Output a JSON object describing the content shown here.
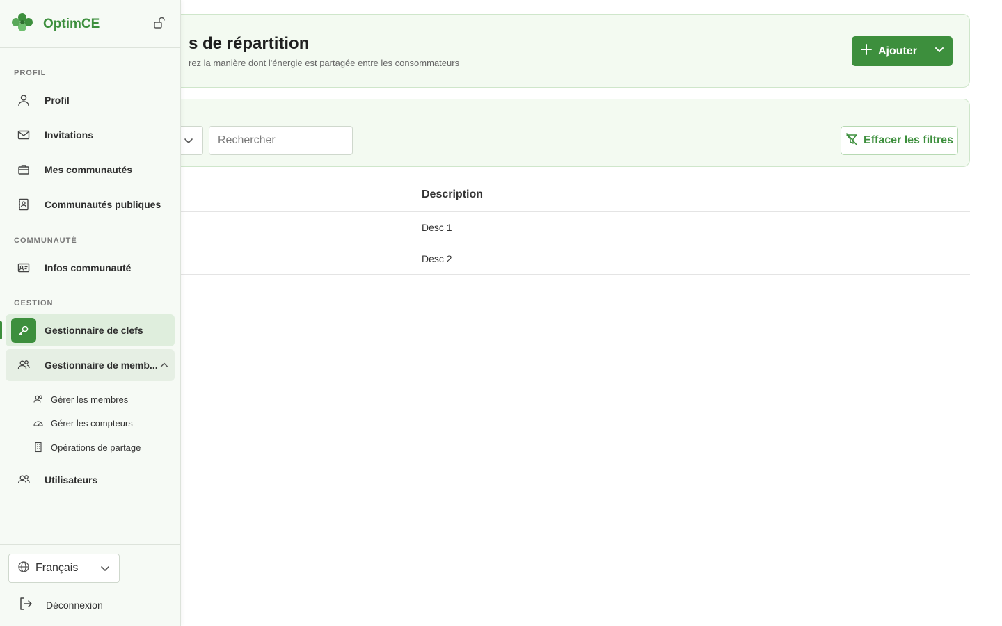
{
  "brand": {
    "name": "OptimCE"
  },
  "header": {
    "title": "s de répartition",
    "subtitle": "rez la manière dont l'énergie est partagée entre les consommateurs",
    "add_label": "Ajouter"
  },
  "filters": {
    "search_placeholder": "Rechercher",
    "clear_label": "Effacer les filtres"
  },
  "table": {
    "headers": {
      "description": "Description"
    },
    "rows": [
      {
        "description": "Desc 1"
      },
      {
        "description": "Desc 2"
      }
    ]
  },
  "sidebar": {
    "sections": {
      "profile": "PROFIL",
      "community": "COMMUNAUTÉ",
      "management": "GESTION"
    },
    "items": {
      "profile": "Profil",
      "invitations": "Invitations",
      "my_communities": "Mes communautés",
      "public_communities": "Communautés publiques",
      "community_info": "Infos communauté",
      "key_manager": "Gestionnaire de clefs",
      "member_manager": "Gestionnaire de memb...",
      "users": "Utilisateurs"
    },
    "subitems": {
      "manage_members": "Gérer les membres",
      "manage_meters": "Gérer les compteurs",
      "sharing_operations": "Opérations de partage"
    },
    "language": "Français",
    "logout": "Déconnexion"
  },
  "colors": {
    "accent": "#3d8f3d",
    "card_bg": "#f3faf1",
    "sidebar_bg": "#f6faf5"
  }
}
